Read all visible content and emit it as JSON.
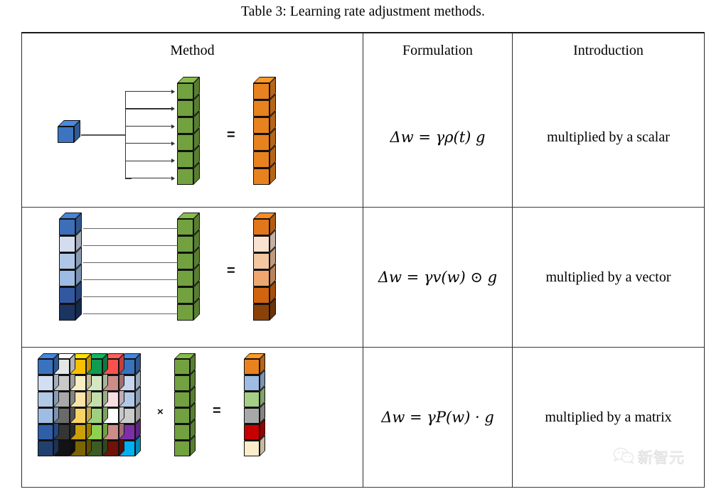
{
  "caption": "Table 3: Learning rate adjustment methods.",
  "table": {
    "columns": [
      {
        "key": "method",
        "label": "Method"
      },
      {
        "key": "formulation",
        "label": "Formulation"
      },
      {
        "key": "introduction",
        "label": "Introduction"
      }
    ],
    "rows": [
      {
        "id": "scalar",
        "formulation": "Δw = γρ(t) g",
        "formulation_parts": {
          "delta_w": "Δw",
          "equals": "=",
          "gamma": "γ",
          "rho_t": "ρ(t)",
          "g": "g"
        },
        "introduction": "multiplied by a scalar",
        "diagram": {
          "type": "scalar-times-vector",
          "operator_symbols": [
            "="
          ],
          "scalar_color": "#3d74bf",
          "vector_color": "#72a13f",
          "result_color": "#e8821e",
          "vector_length": 6,
          "fan_out_arrows": 6
        }
      },
      {
        "id": "vector",
        "formulation": "Δw = γv(w) ⊙ g",
        "formulation_parts": {
          "delta_w": "Δw",
          "equals": "=",
          "gamma": "γ",
          "v_w": "v(w)",
          "op": "⊙",
          "g": "g"
        },
        "introduction": "multiplied by a vector",
        "diagram": {
          "type": "vector-hadamard-vector",
          "operator_symbols": [
            "="
          ],
          "left_colors": [
            "#3d6fb8",
            "#d3ddef",
            "#afc6e6",
            "#9dbbe3",
            "#32589f",
            "#1b3461"
          ],
          "middle_color": "#72a13f",
          "result_colors": [
            "#e2761b",
            "#fae2d0",
            "#f4c7a1",
            "#eea86f",
            "#d1650f",
            "#8a4208"
          ],
          "vector_length": 6
        }
      },
      {
        "id": "matrix",
        "formulation": "Δw = γP(w) · g",
        "formulation_parts": {
          "delta_w": "Δw",
          "equals": "=",
          "gamma": "γ",
          "P_w": "P(w)",
          "op": "·",
          "g": "g"
        },
        "introduction": "multiplied by a matrix",
        "diagram": {
          "type": "matrix-times-vector",
          "operator_symbols": [
            "×",
            "="
          ],
          "matrix_rows": 6,
          "matrix_cols": 6,
          "matrix_colors": [
            [
              "#3a72bd",
              "#e5e5e5",
              "#f8bf00",
              "#0f9b52",
              "#f8514e",
              "#3a72bd"
            ],
            [
              "#d2def1",
              "#c9c9c9",
              "#f8eec4",
              "#d4e7c3",
              "#cb8d8a",
              "#c7d6ee"
            ],
            [
              "#b1c8e7",
              "#a8a8a8",
              "#fae3a8",
              "#c2deaa",
              "#f8dde4",
              "#b1c8e7"
            ],
            [
              "#9fbde4",
              "#6a6a6a",
              "#fad364",
              "#9ed07e",
              "#ffffff",
              "#cbcbcb"
            ],
            [
              "#2f5fa8",
              "#353535",
              "#caa006",
              "#8ed04f",
              "#cb8d8a",
              "#7d2fa8"
            ],
            [
              "#22406e",
              "#131313",
              "#7d6402",
              "#3b5c24",
              "#701209",
              "#00b0f0"
            ]
          ],
          "middle_color": "#72a13f",
          "result_colors": [
            "#e8821e",
            "#9dbbe3",
            "#a4cf85",
            "#a8a8a8",
            "#c60000",
            "#fbecca"
          ]
        }
      }
    ]
  },
  "watermark": {
    "icon": "wechat-logo",
    "text": "新智元"
  }
}
